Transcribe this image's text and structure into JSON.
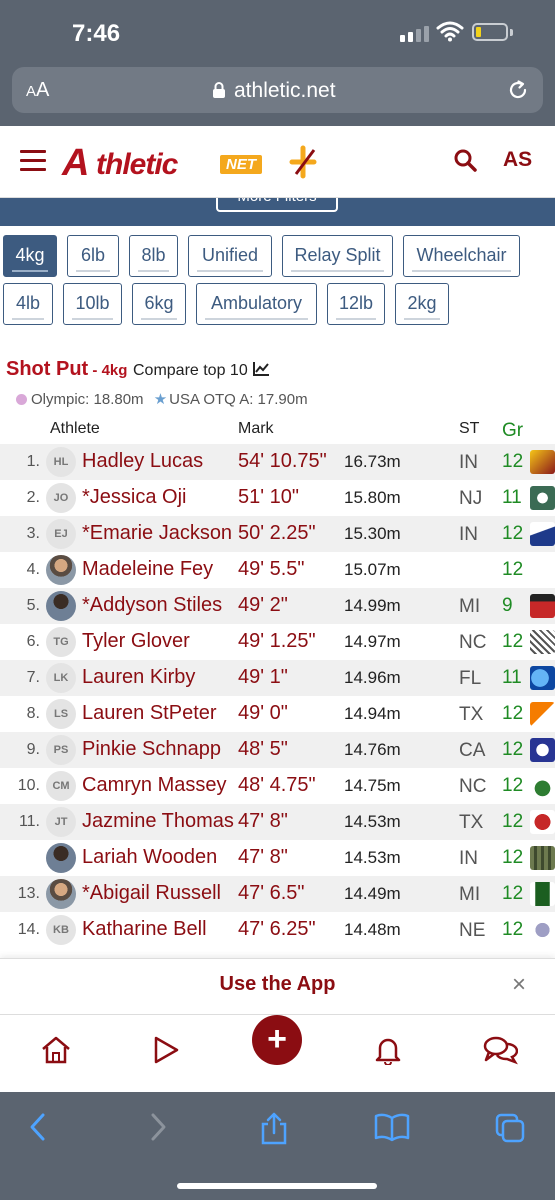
{
  "status_bar": {
    "time": "7:46"
  },
  "browser": {
    "aa_label_big": "A",
    "aa_label_small": "A",
    "url": "athletic.net"
  },
  "site": {
    "logo_a": "A",
    "logo_text": "thletic",
    "logo_net": "NET",
    "account_initials": "AS",
    "more_filters": "More Filters"
  },
  "filters": [
    "4kg",
    "6lb",
    "8lb",
    "Unified",
    "Relay Split",
    "Wheelchair",
    "4lb",
    "10lb",
    "6kg",
    "Ambulatory",
    "12lb",
    "2kg"
  ],
  "active_filter": "4kg",
  "event": {
    "title": "Shot Put",
    "separator": " - ",
    "weight": "4kg",
    "compare": "Compare top 10",
    "olympic": "Olympic: 18.80m",
    "usa_otq": "USA OTQ A: 17.90m"
  },
  "table": {
    "headers": {
      "athlete": "Athlete",
      "mark": "Mark",
      "st": "ST",
      "gr": "Gr"
    },
    "rows": [
      {
        "rank": "1.",
        "initials": "HL",
        "name": "Hadley Lucas",
        "mark": "54' 10.75\"",
        "metric": "16.73m",
        "st": "IN",
        "gr": "12"
      },
      {
        "rank": "2.",
        "initials": "JO",
        "name": "*Jessica Oji",
        "mark": "51' 10\"",
        "metric": "15.80m",
        "st": "NJ",
        "gr": "11"
      },
      {
        "rank": "3.",
        "initials": "EJ",
        "name": "*Emarie Jackson",
        "mark": "50' 2.25\"",
        "metric": "15.30m",
        "st": "IN",
        "gr": "12"
      },
      {
        "rank": "4.",
        "initials": "",
        "name": "Madeleine Fey",
        "mark": "49' 5.5\"",
        "metric": "15.07m",
        "st": "",
        "gr": "12"
      },
      {
        "rank": "5.",
        "initials": "",
        "name": "*Addyson Stiles",
        "mark": "49' 2\"",
        "metric": "14.99m",
        "st": "MI",
        "gr": "9"
      },
      {
        "rank": "6.",
        "initials": "TG",
        "name": "Tyler Glover",
        "mark": "49' 1.25\"",
        "metric": "14.97m",
        "st": "NC",
        "gr": "12"
      },
      {
        "rank": "7.",
        "initials": "LK",
        "name": "Lauren Kirby",
        "mark": "49' 1\"",
        "metric": "14.96m",
        "st": "FL",
        "gr": "11"
      },
      {
        "rank": "8.",
        "initials": "LS",
        "name": "Lauren StPeter",
        "mark": "49' 0\"",
        "metric": "14.94m",
        "st": "TX",
        "gr": "12"
      },
      {
        "rank": "9.",
        "initials": "PS",
        "name": "Pinkie Schnapp",
        "mark": "48' 5\"",
        "metric": "14.76m",
        "st": "CA",
        "gr": "12"
      },
      {
        "rank": "10.",
        "initials": "CM",
        "name": "Camryn Massey",
        "mark": "48' 4.75\"",
        "metric": "14.75m",
        "st": "NC",
        "gr": "12"
      },
      {
        "rank": "11.",
        "initials": "JT",
        "name": "Jazmine Thomas",
        "mark": "47' 8\"",
        "metric": "14.53m",
        "st": "TX",
        "gr": "12"
      },
      {
        "rank": "",
        "initials": "",
        "name": "Lariah Wooden",
        "mark": "47' 8\"",
        "metric": "14.53m",
        "st": "IN",
        "gr": "12"
      },
      {
        "rank": "13.",
        "initials": "",
        "name": "*Abigail Russell",
        "mark": "47' 6.5\"",
        "metric": "14.49m",
        "st": "MI",
        "gr": "12"
      },
      {
        "rank": "14.",
        "initials": "KB",
        "name": "Katharine Bell",
        "mark": "47' 6.25\"",
        "metric": "14.48m",
        "st": "NE",
        "gr": "12"
      }
    ]
  },
  "app_banner": {
    "text": "Use the App",
    "close": "×"
  },
  "bottom_nav": {
    "plus": "+"
  },
  "colors": {
    "brand": "#8b0d12",
    "filter_blue": "#3d5b80",
    "grade_green": "#1f8b24"
  }
}
